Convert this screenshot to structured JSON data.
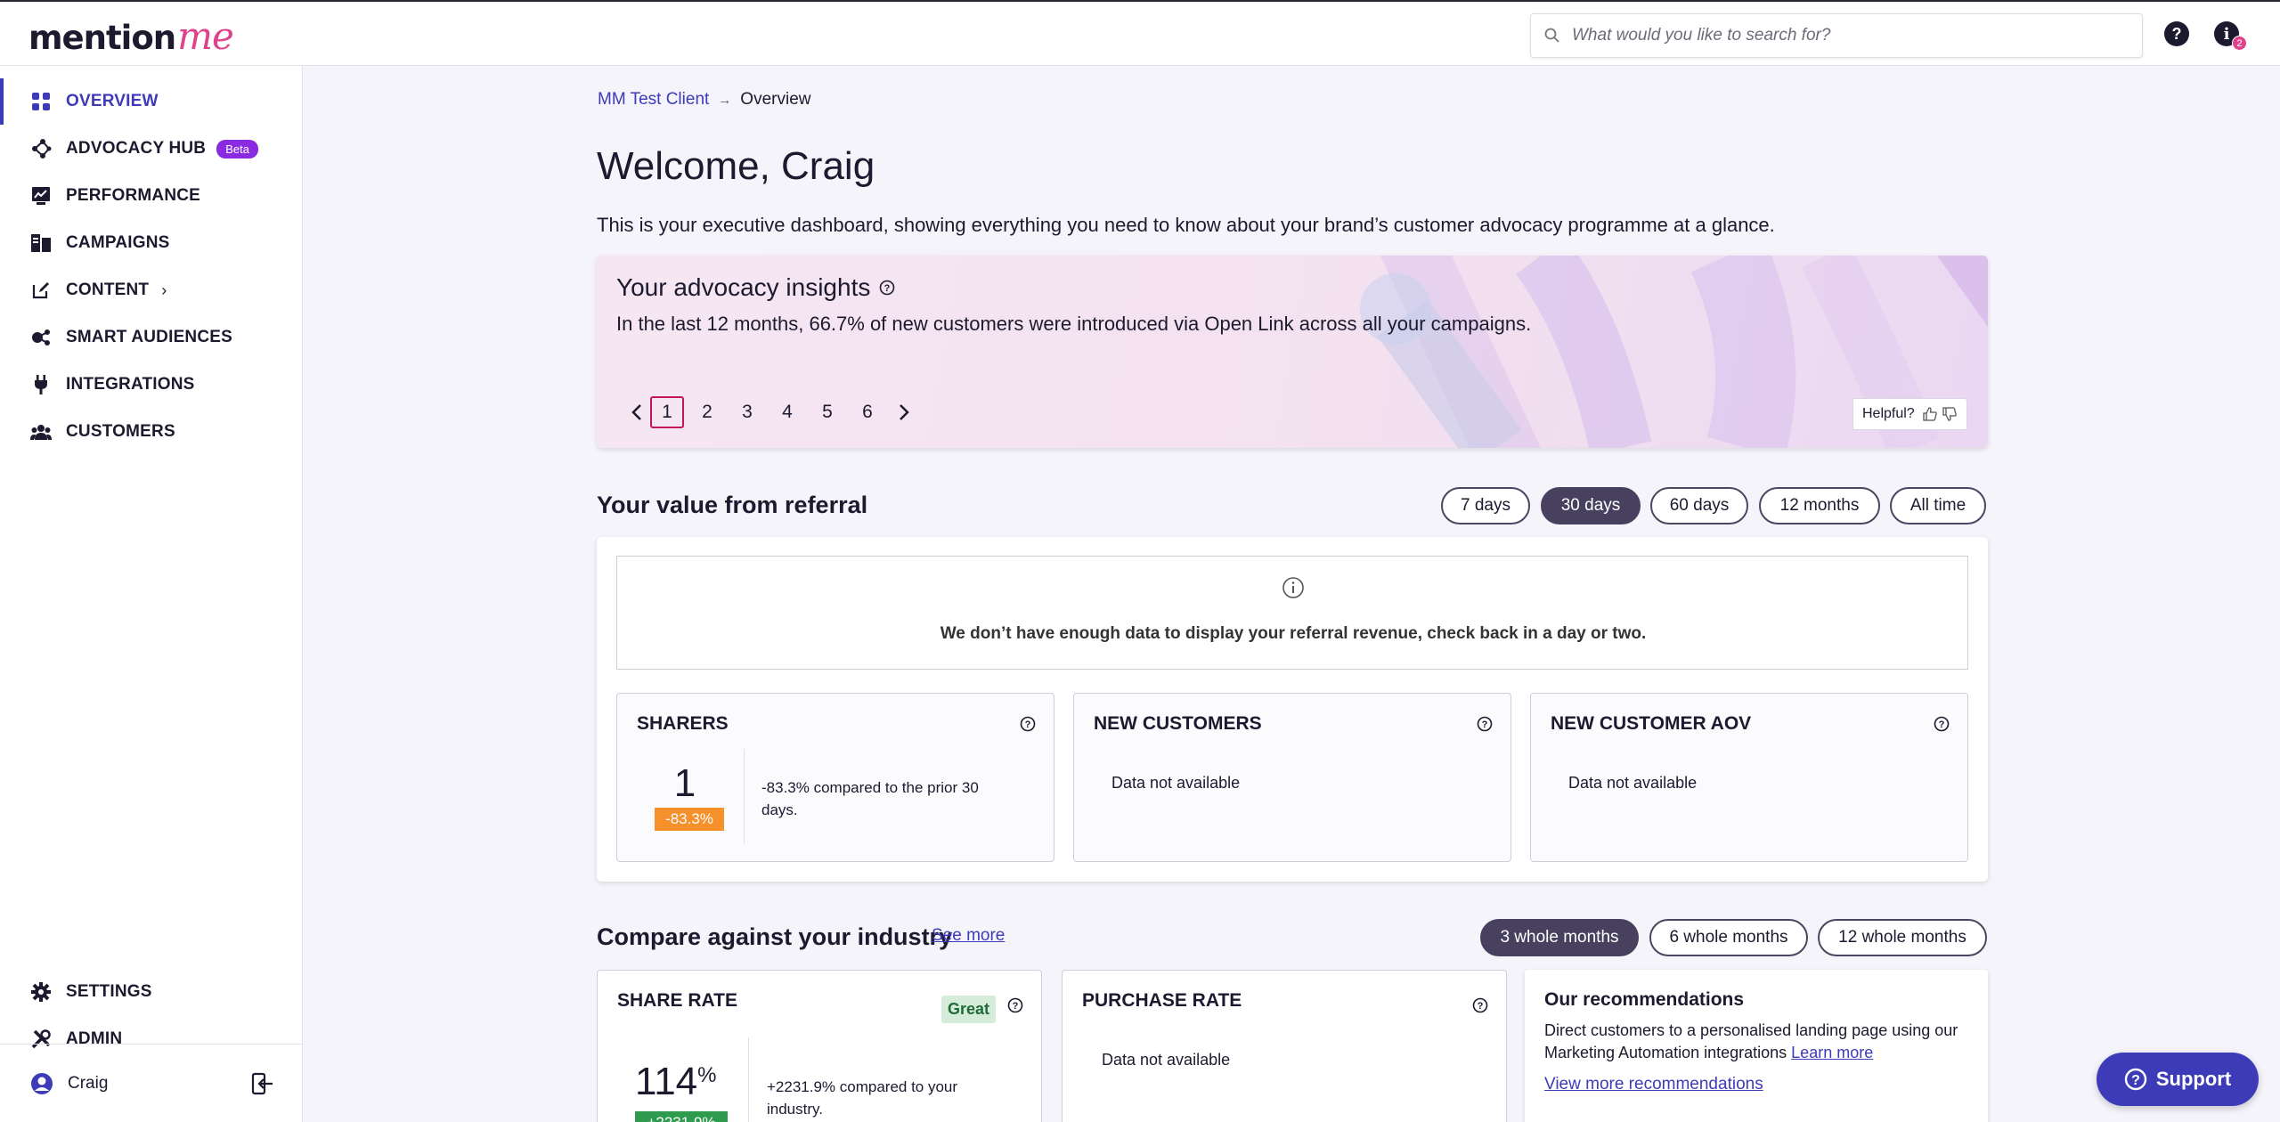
{
  "header": {
    "logo_part1": "mention",
    "logo_part2": "me",
    "search_placeholder": "What would you like to search for?",
    "help_icon": "question-circle-icon",
    "info_icon": "info-circle-icon",
    "notification_count": "2"
  },
  "sidebar": {
    "items": [
      {
        "label": "OVERVIEW",
        "icon": "grid-icon",
        "active": true
      },
      {
        "label": "ADVOCACY HUB",
        "icon": "network-icon",
        "badge": "Beta"
      },
      {
        "label": "PERFORMANCE",
        "icon": "chart-icon"
      },
      {
        "label": "CAMPAIGNS",
        "icon": "campaigns-icon"
      },
      {
        "label": "CONTENT",
        "icon": "edit-icon",
        "chevron": "›"
      },
      {
        "label": "SMART AUDIENCES",
        "icon": "audience-icon"
      },
      {
        "label": "INTEGRATIONS",
        "icon": "plug-icon"
      },
      {
        "label": "CUSTOMERS",
        "icon": "users-icon"
      }
    ],
    "bottom_items": [
      {
        "label": "SETTINGS",
        "icon": "gear-icon"
      },
      {
        "label": "ADMIN",
        "icon": "tools-icon"
      }
    ],
    "user": {
      "name": "Craig"
    }
  },
  "breadcrumb": {
    "parent": "MM Test Client",
    "separator": "→",
    "current": "Overview"
  },
  "page": {
    "title": "Welcome, Craig",
    "intro": "This is your executive dashboard, showing everything you need to know about your brand’s customer advocacy programme at a glance."
  },
  "insights": {
    "title": "Your advocacy insights",
    "text": "In the last 12 months, 66.7% of new customers were introduced via Open Link across all your campaigns.",
    "pages": [
      "1",
      "2",
      "3",
      "4",
      "5",
      "6"
    ],
    "current_page": "1",
    "helpful_label": "Helpful?"
  },
  "referral": {
    "title": "Your value from referral",
    "ranges": [
      "7 days",
      "30 days",
      "60 days",
      "12 months",
      "All time"
    ],
    "selected_range": "30 days",
    "notice": "We don’t have enough data to display your referral revenue, check back in a day or two.",
    "metrics": [
      {
        "title": "SHARERS",
        "value": "1",
        "delta": "-83.3%",
        "comparison": "-83.3% compared to the prior 30 days."
      },
      {
        "title": "NEW CUSTOMERS",
        "empty": "Data not available"
      },
      {
        "title": "NEW CUSTOMER AOV",
        "empty": "Data not available"
      }
    ]
  },
  "industry": {
    "title": "Compare against your industry",
    "see_more": "See more",
    "ranges": [
      "3 whole months",
      "6 whole months",
      "12 whole months"
    ],
    "selected_range": "3 whole months",
    "share_rate": {
      "title": "SHARE RATE",
      "rating": "Great",
      "value": "114",
      "unit": "%",
      "delta": "+2231.9%",
      "comparison": "+2231.9% compared to your industry."
    },
    "purchase_rate": {
      "title": "PURCHASE RATE",
      "empty": "Data not available"
    },
    "recommendations": {
      "title": "Our recommendations",
      "body": "Direct customers to a personalised landing page using our Marketing Automation integrations",
      "learn_more": "Learn more",
      "view_more": "View more recommendations"
    }
  },
  "support": {
    "label": "Support"
  },
  "colors": {
    "accent": "#3d3bb8",
    "brand_pink": "#e0418b",
    "pill_active": "#47405e",
    "delta_orange": "#f5902a",
    "delta_green": "#2e9b4e"
  }
}
